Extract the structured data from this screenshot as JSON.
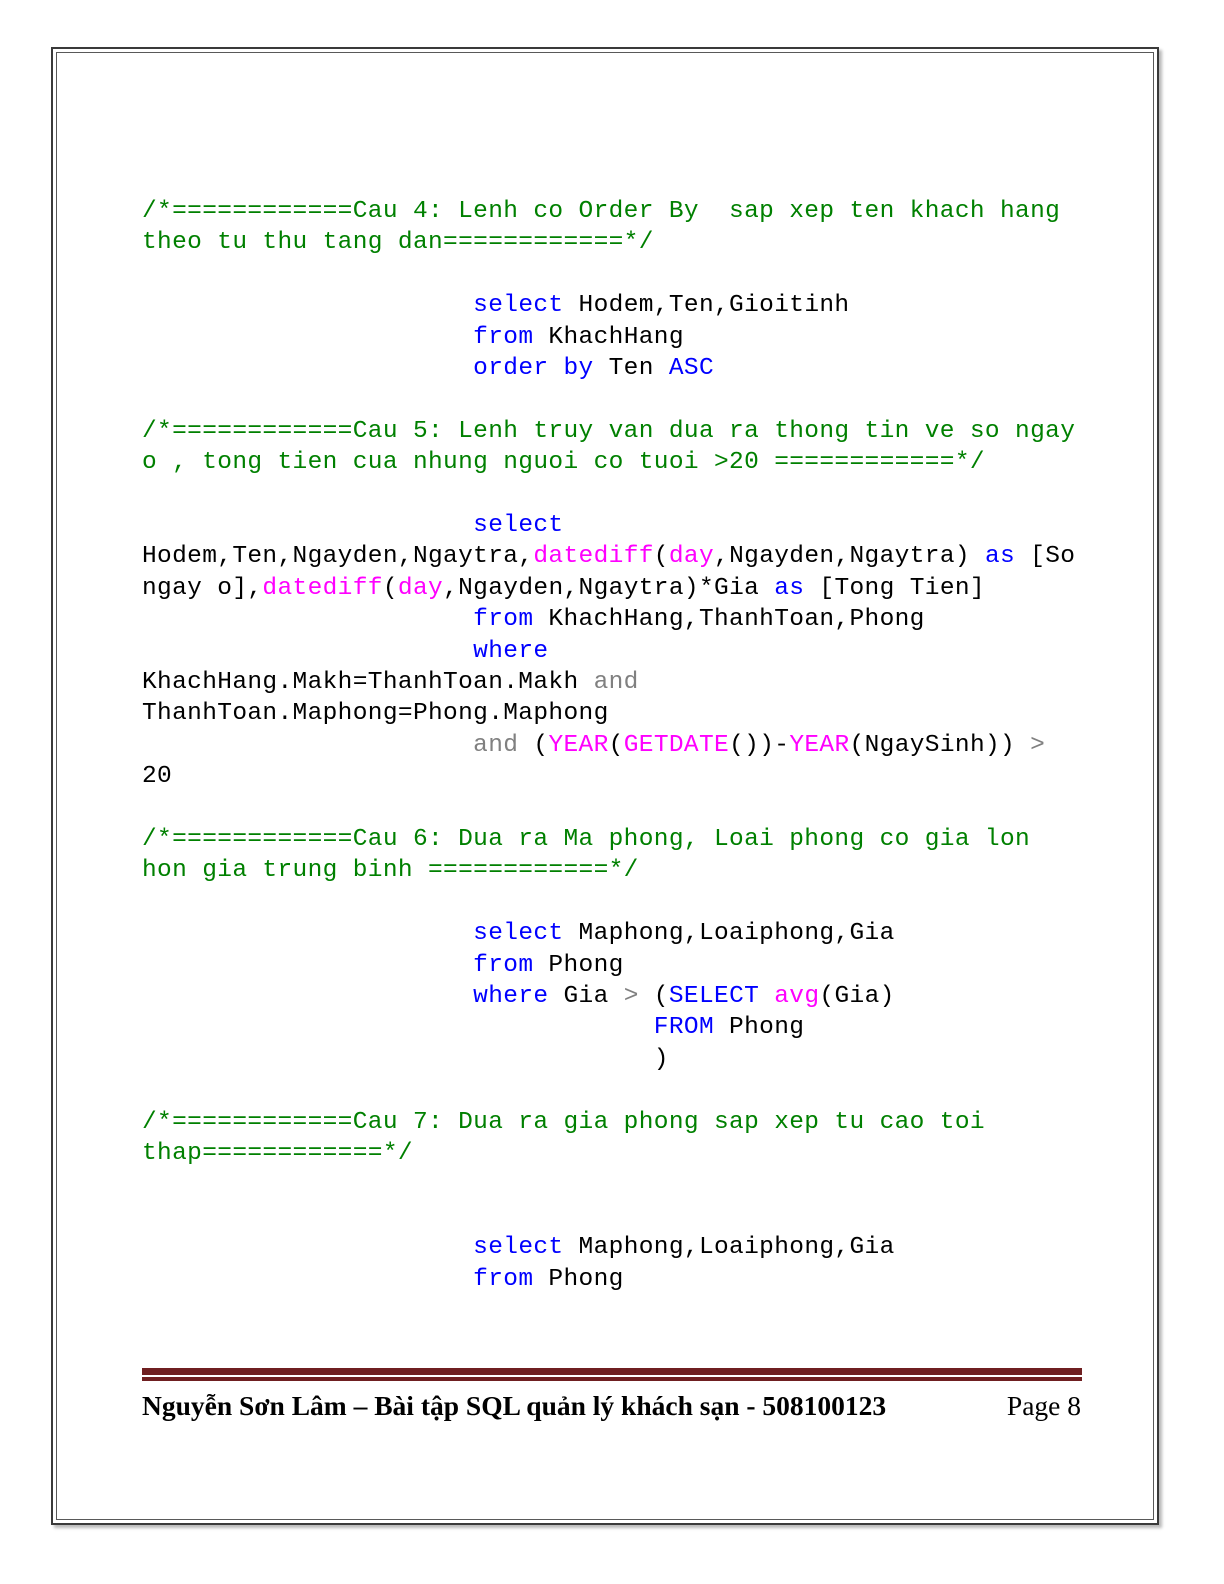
{
  "document": {
    "page_number_label": "Page 8",
    "footer_title": "Nguyễn Sơn Lâm – Bài tập SQL quản lý khách sạn - 508100123",
    "colors": {
      "comment_green": "#008000",
      "keyword_blue": "#0000ff",
      "function_magenta": "#ff00ff",
      "operator_gray": "#808080",
      "plain_black": "#000000",
      "footer_rule_maroon": "#6f1f21",
      "page_border": "#3a3a3a"
    }
  },
  "code": {
    "lines": [
      {
        "id": "l01",
        "segments": [
          {
            "cls": "cmt",
            "text": "/*============Cau 4: Lenh co Order By  sap xep ten khach hang theo tu thu tang dan============*/"
          }
        ]
      },
      {
        "id": "l02",
        "segments": []
      },
      {
        "id": "l03",
        "segments": [
          {
            "cls": "pl",
            "text": "                      "
          },
          {
            "cls": "kw",
            "text": "select"
          },
          {
            "cls": "pl",
            "text": " Hodem,Ten,Gioitinh"
          }
        ]
      },
      {
        "id": "l04",
        "segments": [
          {
            "cls": "pl",
            "text": "                      "
          },
          {
            "cls": "kw",
            "text": "from"
          },
          {
            "cls": "pl",
            "text": " KhachHang"
          }
        ]
      },
      {
        "id": "l05",
        "segments": [
          {
            "cls": "pl",
            "text": "                      "
          },
          {
            "cls": "kw",
            "text": "order by"
          },
          {
            "cls": "pl",
            "text": " Ten "
          },
          {
            "cls": "kw",
            "text": "ASC"
          }
        ]
      },
      {
        "id": "l06",
        "segments": []
      },
      {
        "id": "l07",
        "segments": [
          {
            "cls": "cmt",
            "text": "/*============Cau 5: Lenh truy van dua ra thong tin ve so ngay o , tong tien cua nhung nguoi co tuoi >20 ============*/"
          }
        ]
      },
      {
        "id": "l08",
        "segments": []
      },
      {
        "id": "l09",
        "segments": [
          {
            "cls": "pl",
            "text": "                      "
          },
          {
            "cls": "kw",
            "text": "select"
          }
        ]
      },
      {
        "id": "l10",
        "segments": [
          {
            "cls": "pl",
            "text": "Hodem,Ten,Ngayden,Ngaytra,"
          },
          {
            "cls": "fn",
            "text": "datediff"
          },
          {
            "cls": "pl",
            "text": "("
          },
          {
            "cls": "fn",
            "text": "day"
          },
          {
            "cls": "pl",
            "text": ",Ngayden,Ngaytra) "
          },
          {
            "cls": "kw",
            "text": "as"
          },
          {
            "cls": "pl",
            "text": " [So ngay o],"
          },
          {
            "cls": "fn",
            "text": "datediff"
          },
          {
            "cls": "pl",
            "text": "("
          },
          {
            "cls": "fn",
            "text": "day"
          },
          {
            "cls": "pl",
            "text": ",Ngayden,Ngaytra)*Gia "
          },
          {
            "cls": "kw",
            "text": "as"
          },
          {
            "cls": "pl",
            "text": " [Tong Tien]"
          }
        ]
      },
      {
        "id": "l11",
        "segments": [
          {
            "cls": "pl",
            "text": "                      "
          },
          {
            "cls": "kw",
            "text": "from"
          },
          {
            "cls": "pl",
            "text": " KhachHang,ThanhToan,Phong"
          }
        ]
      },
      {
        "id": "l12",
        "segments": [
          {
            "cls": "pl",
            "text": "                      "
          },
          {
            "cls": "kw",
            "text": "where"
          }
        ]
      },
      {
        "id": "l13",
        "segments": [
          {
            "cls": "pl",
            "text": "KhachHang.Makh=ThanhToan.Makh "
          },
          {
            "cls": "op",
            "text": "and"
          },
          {
            "cls": "pl",
            "text": " ThanhToan.Maphong=Phong.Maphong"
          }
        ]
      },
      {
        "id": "l14",
        "segments": [
          {
            "cls": "pl",
            "text": "                      "
          },
          {
            "cls": "op",
            "text": "and"
          },
          {
            "cls": "pl",
            "text": " ("
          },
          {
            "cls": "fn",
            "text": "YEAR"
          },
          {
            "cls": "pl",
            "text": "("
          },
          {
            "cls": "fn",
            "text": "GETDATE"
          },
          {
            "cls": "pl",
            "text": "())-"
          },
          {
            "cls": "fn",
            "text": "YEAR"
          },
          {
            "cls": "pl",
            "text": "(NgaySinh)) "
          },
          {
            "cls": "op",
            "text": ">"
          },
          {
            "cls": "pl",
            "text": " 20"
          }
        ]
      },
      {
        "id": "l15",
        "segments": []
      },
      {
        "id": "l16",
        "segments": [
          {
            "cls": "cmt",
            "text": "/*============Cau 6: Dua ra Ma phong, Loai phong co gia lon hon gia trung binh ============*/"
          }
        ]
      },
      {
        "id": "l17",
        "segments": []
      },
      {
        "id": "l18",
        "segments": [
          {
            "cls": "pl",
            "text": "                      "
          },
          {
            "cls": "kw",
            "text": "select"
          },
          {
            "cls": "pl",
            "text": " Maphong,Loaiphong,Gia"
          }
        ]
      },
      {
        "id": "l19",
        "segments": [
          {
            "cls": "pl",
            "text": "                      "
          },
          {
            "cls": "kw",
            "text": "from"
          },
          {
            "cls": "pl",
            "text": " Phong"
          }
        ]
      },
      {
        "id": "l20",
        "segments": [
          {
            "cls": "pl",
            "text": "                      "
          },
          {
            "cls": "kw",
            "text": "where"
          },
          {
            "cls": "pl",
            "text": " Gia "
          },
          {
            "cls": "op",
            "text": ">"
          },
          {
            "cls": "pl",
            "text": " ("
          },
          {
            "cls": "kw",
            "text": "SELECT"
          },
          {
            "cls": "pl",
            "text": " "
          },
          {
            "cls": "fn",
            "text": "avg"
          },
          {
            "cls": "pl",
            "text": "(Gia)"
          }
        ]
      },
      {
        "id": "l21",
        "segments": [
          {
            "cls": "pl",
            "text": "                                  "
          },
          {
            "cls": "kw",
            "text": "FROM"
          },
          {
            "cls": "pl",
            "text": " Phong"
          }
        ]
      },
      {
        "id": "l22",
        "segments": [
          {
            "cls": "pl",
            "text": "                                  )"
          }
        ]
      },
      {
        "id": "l23",
        "segments": []
      },
      {
        "id": "l24",
        "segments": [
          {
            "cls": "cmt",
            "text": "/*============Cau 7: Dua ra gia phong sap xep tu cao toi thap============*/"
          }
        ]
      },
      {
        "id": "l25",
        "segments": []
      },
      {
        "id": "l26",
        "segments": []
      },
      {
        "id": "l27",
        "segments": [
          {
            "cls": "pl",
            "text": "                      "
          },
          {
            "cls": "kw",
            "text": "select"
          },
          {
            "cls": "pl",
            "text": " Maphong,Loaiphong,Gia"
          }
        ]
      },
      {
        "id": "l28",
        "segments": [
          {
            "cls": "pl",
            "text": "                      "
          },
          {
            "cls": "kw",
            "text": "from"
          },
          {
            "cls": "pl",
            "text": " Phong"
          }
        ]
      }
    ]
  }
}
